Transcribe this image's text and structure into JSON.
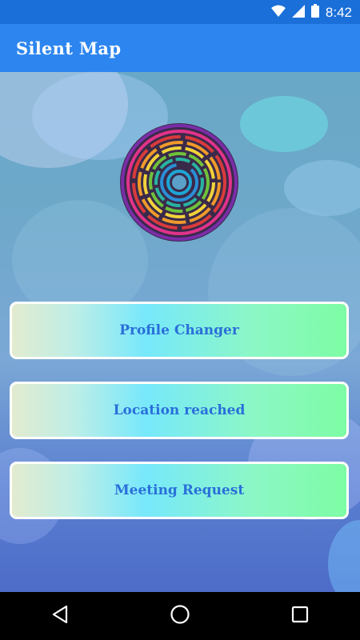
{
  "status_bar": {
    "time": "8:42"
  },
  "app_bar": {
    "title": "Silent Map"
  },
  "menu": [
    {
      "label": "Profile Changer"
    },
    {
      "label": "Location reached"
    },
    {
      "label": "Meeting Request"
    }
  ],
  "colors": {
    "status_bar": "#1a6fd8",
    "app_bar": "#2d86f0",
    "button_text": "#2a6fd9"
  },
  "icons": [
    "wifi-icon",
    "signal-icon",
    "battery-icon",
    "app-logo-icon",
    "back-icon",
    "home-icon",
    "recents-icon"
  ]
}
